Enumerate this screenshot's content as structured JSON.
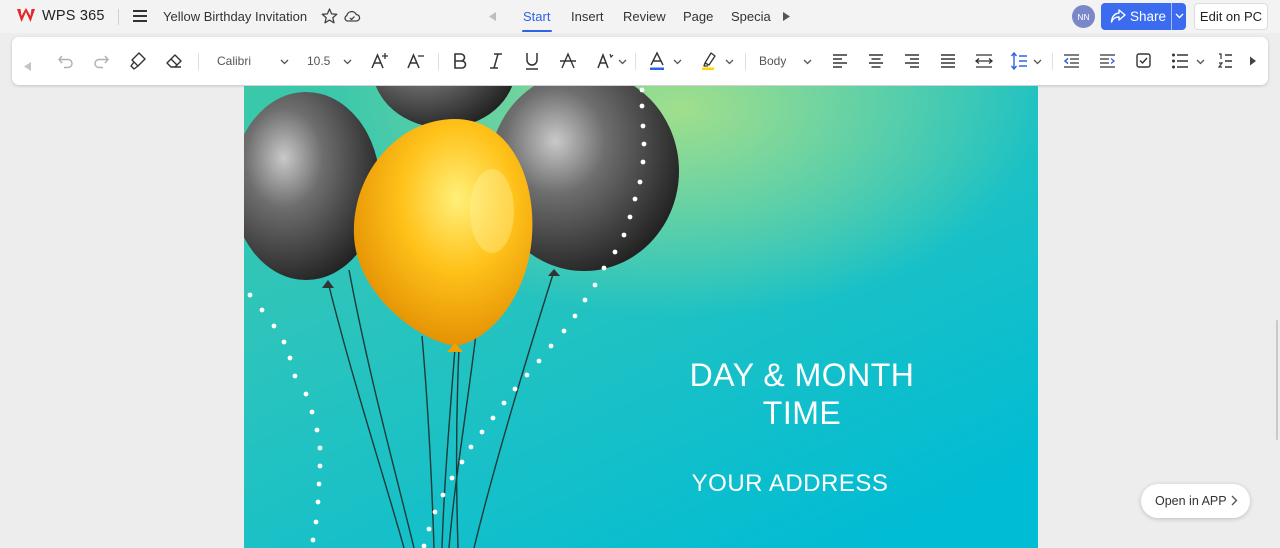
{
  "app": {
    "name": "WPS 365",
    "brand_color": "#e5262a"
  },
  "document": {
    "title": "Yellow Birthday Invitation"
  },
  "header_icons": [
    "menu-icon",
    "star-icon",
    "cloud-sync-icon",
    "scroll-left-icon",
    "scroll-right-icon"
  ],
  "tabs": [
    {
      "label": "Start",
      "active": true
    },
    {
      "label": "Insert"
    },
    {
      "label": "Review"
    },
    {
      "label": "Page"
    },
    {
      "label": "Specia"
    }
  ],
  "user": {
    "initials": "NN"
  },
  "share": {
    "label": "Share",
    "color": "#3b6cf0"
  },
  "edit_pc": {
    "label": "Edit on PC"
  },
  "toolbar": {
    "font_name": "Calibri",
    "font_size": "10.5",
    "paragraph_style": "Body",
    "icons": [
      "collapse-left-icon",
      "undo-icon",
      "redo-icon",
      "format-painter-icon",
      "eraser-icon",
      "increase-font-icon",
      "decrease-font-icon",
      "bold-icon",
      "italic-icon",
      "underline-icon",
      "strikethrough-icon",
      "text-effect-icon",
      "font-color-icon",
      "highlight-icon",
      "align-left-icon",
      "align-center-icon",
      "align-right-icon",
      "justify-icon",
      "distributed-icon",
      "line-spacing-icon",
      "decrease-indent-icon",
      "increase-indent-icon",
      "checkbox-icon",
      "bullet-list-icon",
      "numbered-list-icon",
      "toolbar-scroll-right-icon"
    ],
    "font_color": "#2e63e8",
    "highlight_color": "#ffd600"
  },
  "invitation": {
    "line1": "DAY & MONTH",
    "line2": "TIME",
    "address": "YOUR ADDRESS",
    "background": "#00bcd4",
    "balloon_color": "#ffb300"
  },
  "open_app": {
    "label": "Open in APP"
  }
}
